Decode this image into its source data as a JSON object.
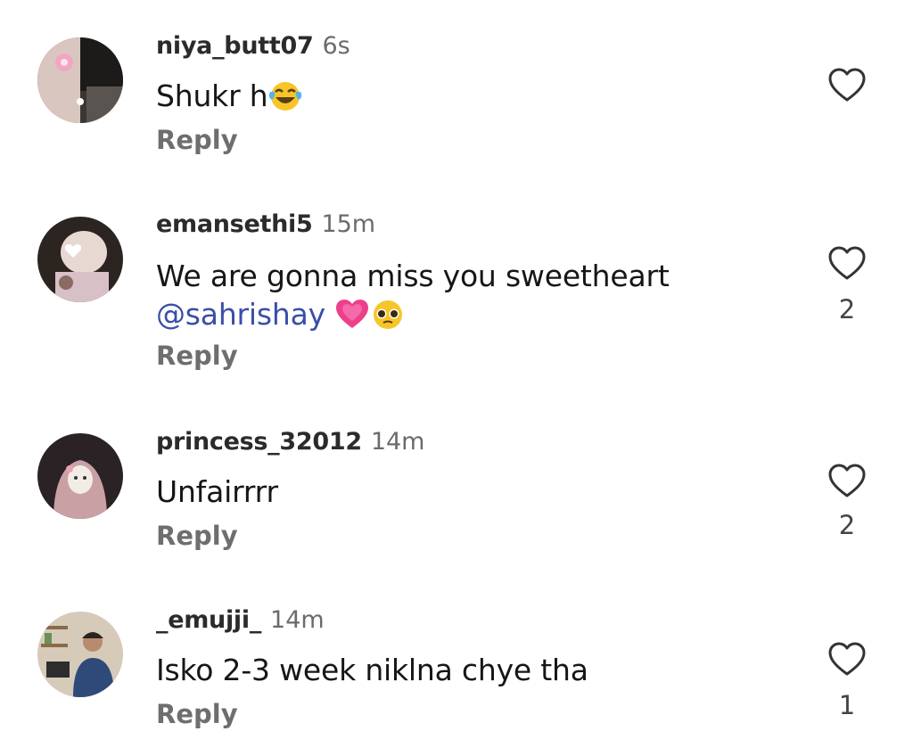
{
  "comments": [
    {
      "username": "niya_butt07",
      "time": "6s",
      "text": "Shukr h",
      "text_emoji": "face-with-tears-of-joy",
      "reply": "Reply",
      "likes": ""
    },
    {
      "username": "emansethi5",
      "time": "15m",
      "text": "We are gonna miss you sweetheart",
      "mention": "@sahrishay",
      "text_emoji": [
        "growing-heart",
        "pleading-face"
      ],
      "reply": "Reply",
      "likes": "2"
    },
    {
      "username": "princess_32012",
      "time": "14m",
      "text": "Unfairrrr",
      "reply": "Reply",
      "likes": "2"
    },
    {
      "username": "_emujji_",
      "time": "14m",
      "text": "Isko 2-3 week niklna chye tha",
      "reply": "Reply",
      "likes": "1"
    }
  ],
  "colors": {
    "mention": "#3a4fa8",
    "reply": "#6e6e6e",
    "username": "#2b2b2b",
    "time": "#6b6b6b",
    "heart_outline": "#333333"
  },
  "icons": {
    "like": "heart-outline-icon"
  }
}
